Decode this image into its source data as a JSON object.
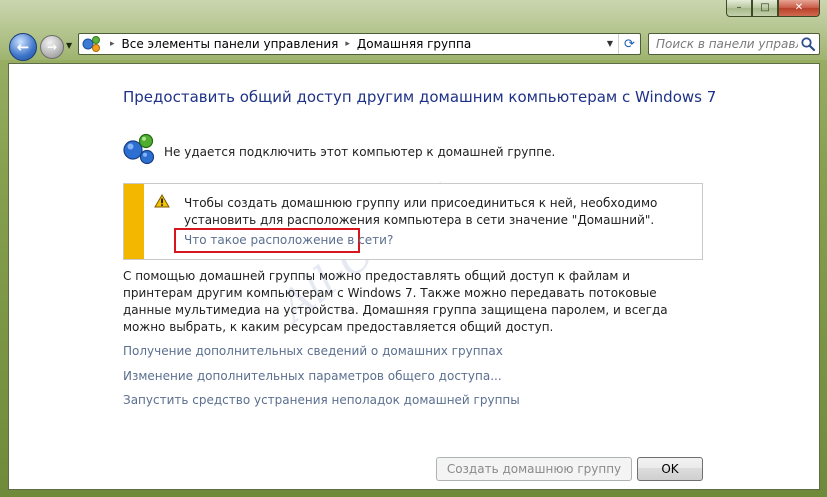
{
  "window": {
    "controls": {
      "minimize": "–",
      "maximize": "□",
      "close": "✕"
    }
  },
  "nav": {
    "back_icon": "arrow-left-icon",
    "forward_icon": "arrow-right-icon"
  },
  "address_bar": {
    "crumbs": [
      "Все элементы панели управления",
      "Домашняя группа"
    ],
    "separator": "▸"
  },
  "search": {
    "placeholder": "Поиск в панели управл..."
  },
  "main": {
    "title": "Предоставить общий доступ другим домашним компьютерам с Windows 7",
    "status": "Не удается подключить этот компьютер к домашней группе.",
    "warning": {
      "text": "Чтобы создать домашнюю группу или присоединиться к ней, необходимо установить для расположения компьютера в сети значение \"Домашний\".",
      "link": "Что такое расположение в сети?"
    },
    "description": "С помощью домашней группы можно предоставлять общий доступ к файлам и принтерам другим компьютерам с Windows 7. Также можно передавать потоковые данные мультимедиа на устройства. Домашняя группа защищена паролем, и всегда можно выбрать, к каким ресурсам предоставляется общий доступ.",
    "links": [
      "Получение дополнительных сведений о домашних группах",
      "Изменение дополнительных параметров общего доступа...",
      "Запустить средство устранения неполадок домашней группы"
    ],
    "watermark": "All-OS.Ru"
  },
  "buttons": {
    "create": "Создать домашнюю группу",
    "ok": "OK"
  },
  "colors": {
    "title": "#1e3287",
    "link": "#5b6f8f",
    "warning_bar": "#f3b700",
    "highlight_border": "#d7161e"
  }
}
